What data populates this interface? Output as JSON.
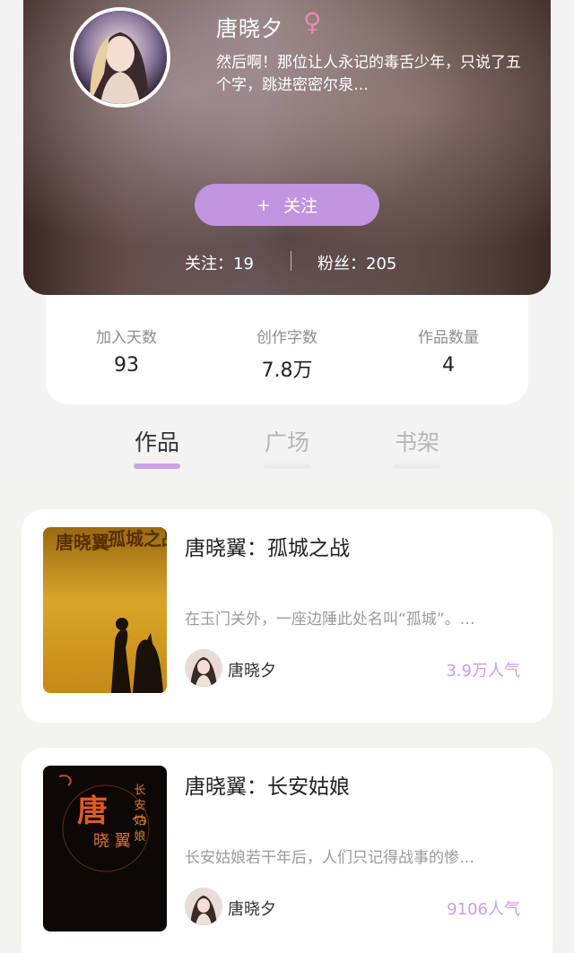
{
  "profile": {
    "username": "唐晓夕",
    "gender_symbol": "♀",
    "bio": "然后啊！那位让人永记的毒舌少年，只说了五个字，跳进密密尔泉…",
    "follow_button": {
      "icon": "+",
      "label": "关注"
    },
    "following_label": "关注：19",
    "fans_label": "粉丝：205"
  },
  "stats": [
    {
      "label": "加入天数",
      "value": "93"
    },
    {
      "label": "创作字数",
      "value": "7.8万"
    },
    {
      "label": "作品数量",
      "value": "4"
    }
  ],
  "tabs": [
    {
      "label": "作品",
      "active": true
    },
    {
      "label": "广场",
      "active": false
    },
    {
      "label": "书架",
      "active": false
    }
  ],
  "books": [
    {
      "title": "唐晓翼：孤城之战",
      "description": "在玉门关外，一座边陲此处名叫“孤城”。…",
      "author": "唐晓夕",
      "popularity": "3.9万人气",
      "cover_text": {
        "left_col": "唐晓翼",
        "right_col": "孤城之战"
      }
    },
    {
      "title": "唐晓翼：长安姑娘",
      "description": "长安姑娘若干年后，人们只记得战事的惨…",
      "author": "唐晓夕",
      "popularity": "9106人气",
      "cover_text": {
        "main": "唐",
        "sub": "晓 翼",
        "side": "长 安 姑 娘"
      }
    }
  ],
  "colors": {
    "accent": "#c094de",
    "popularity": "#c89ee6",
    "gender": "#e68aa8"
  }
}
